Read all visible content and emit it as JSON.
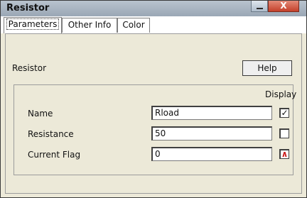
{
  "window": {
    "title": "Resistor",
    "close_symbol": "X"
  },
  "tabs": [
    {
      "label": "Parameters"
    },
    {
      "label": "Other Info"
    },
    {
      "label": "Color"
    }
  ],
  "panel": {
    "section_title": "Resistor",
    "help_label": "Help",
    "display_label": "Display",
    "rows": [
      {
        "label": "Name",
        "value": "Rload",
        "display_mark": "✓"
      },
      {
        "label": "Resistance",
        "value": "50",
        "display_mark": ""
      },
      {
        "label": "Current Flag",
        "value": "0",
        "display_mark": "∧"
      }
    ]
  },
  "colors": {
    "flag_mark": "#cc1f1f",
    "titlebar": "#9aa7b5",
    "close_button": "#c4402a"
  }
}
